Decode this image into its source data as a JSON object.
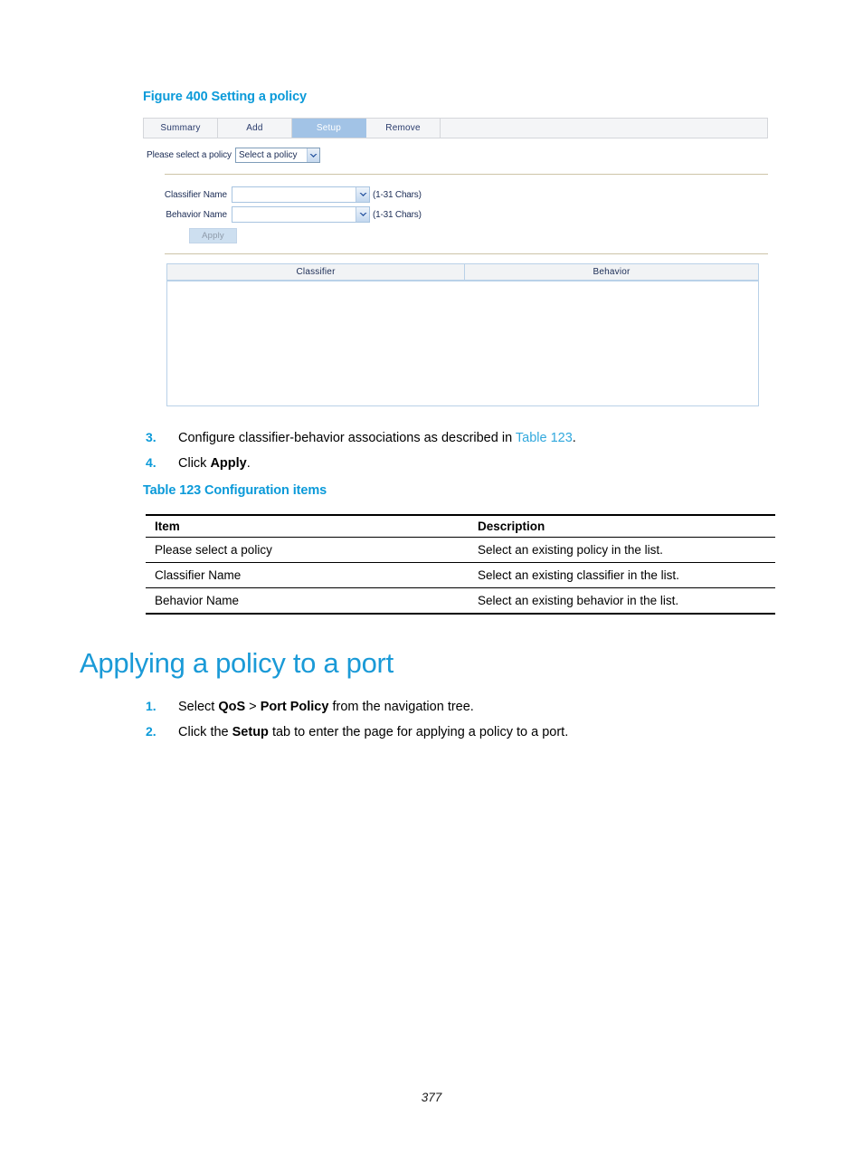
{
  "figure": {
    "caption": "Figure 400 Setting a policy",
    "tabs": [
      {
        "label": "Summary",
        "active": false
      },
      {
        "label": "Add",
        "active": false
      },
      {
        "label": "Setup",
        "active": true
      },
      {
        "label": "Remove",
        "active": false
      }
    ],
    "policy_row": {
      "label": "Please select a policy",
      "select_value": "Select a policy"
    },
    "fields": [
      {
        "label": "Classifier Name",
        "value": "",
        "hint": "(1-31 Chars)"
      },
      {
        "label": "Behavior Name",
        "value": "",
        "hint": "(1-31 Chars)"
      }
    ],
    "apply_button": "Apply",
    "result_table": {
      "columns": [
        "Classifier",
        "Behavior"
      ],
      "rows": []
    },
    "colors": {
      "active_tab_bg": "#a2c3e6",
      "tabbar_bg": "#f3f4f6",
      "table_border": "#b9d1e8",
      "divider": "#cdc4a8",
      "apply_bg": "#cddff0"
    }
  },
  "steps_after_figure": [
    {
      "num": "3.",
      "text_before": "Configure classifier-behavior associations as described in ",
      "xref": "Table 123",
      "text_after": "."
    },
    {
      "num": "4.",
      "text_before": "Click ",
      "bold": "Apply",
      "text_after": "."
    }
  ],
  "config_table": {
    "caption": "Table 123 Configuration items",
    "headers": [
      "Item",
      "Description"
    ],
    "rows": [
      [
        "Please select a policy",
        "Select an existing policy in the list."
      ],
      [
        "Classifier Name",
        "Select an existing classifier in the list."
      ],
      [
        "Behavior Name",
        "Select an existing behavior in the list."
      ]
    ]
  },
  "section": {
    "heading": "Applying a policy to a port",
    "steps": [
      {
        "num": "1.",
        "seg1": "Select ",
        "bold1": "QoS",
        "seg2": " > ",
        "bold2": "Port Policy",
        "seg3": " from the navigation tree."
      },
      {
        "num": "2.",
        "seg1": "Click the ",
        "bold1": "Setup",
        "seg2": " tab to enter the page for applying a policy to a port.",
        "bold2": "",
        "seg3": ""
      }
    ]
  },
  "footer": {
    "page_number": "377"
  },
  "theme": {
    "accent": "#0b9ad9",
    "heading": "#1a9ad7",
    "xref": "#31a8dd"
  }
}
